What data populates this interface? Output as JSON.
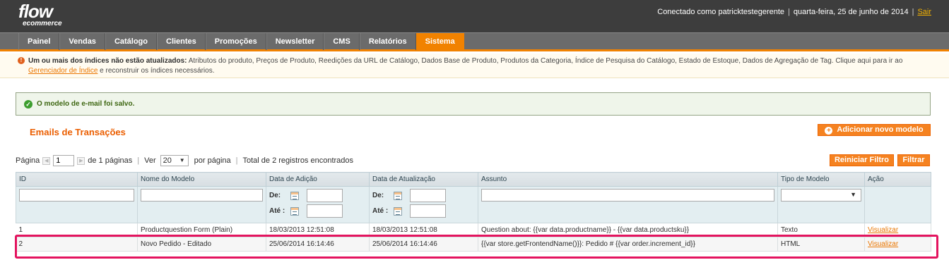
{
  "header": {
    "logo_main": "flow",
    "logo_sub": "ecommerce",
    "logged_in": "Conectado como patricktestegerente",
    "date": "quarta-feira, 25 de junho de 2014",
    "logout": "Sair"
  },
  "nav": {
    "items": [
      {
        "label": "Painel"
      },
      {
        "label": "Vendas"
      },
      {
        "label": "Catálogo"
      },
      {
        "label": "Clientes"
      },
      {
        "label": "Promoções"
      },
      {
        "label": "Newsletter"
      },
      {
        "label": "CMS"
      },
      {
        "label": "Relatórios"
      },
      {
        "label": "Sistema"
      }
    ],
    "active": "Sistema"
  },
  "notice": {
    "bold": "Um ou mais dos índices não estão atualizados:",
    "text": " Atributos do produto, Preços de Produto, Reedições da URL de Catálogo, Dados Base de Produto, Produtos da Categoria, Índice de Pesquisa do Catálogo, Estado de Estoque, Dados de Agregação de Tag. Clique aqui para ir ao ",
    "link": "Gerenciador de Índice",
    "tail": " e reconstruir os índices necessários."
  },
  "success": {
    "message": "O modelo de e-mail foi salvo."
  },
  "page": {
    "title": "Emails de Transações",
    "add_button": "Adicionar novo modelo",
    "reset_button": "Reiniciar Filtro",
    "filter_button": "Filtrar"
  },
  "pager": {
    "page_label": "Página",
    "page_value": "1",
    "of_pages": "de 1 páginas",
    "view_label": "Ver",
    "per_page_value": "20",
    "per_page_label": "por página",
    "total": "Total de 2 registros encontrados"
  },
  "grid": {
    "columns": [
      "ID",
      "Nome do Modelo",
      "Data de Adição",
      "Data de Atualização",
      "Assunto",
      "Tipo de Modelo",
      "Ação"
    ],
    "filter": {
      "from": "De:",
      "to": "Até :"
    },
    "rows": [
      {
        "id": "1",
        "name": "Productquestion Form (Plain)",
        "added": "18/03/2013 12:51:08",
        "updated": "18/03/2013 12:51:08",
        "subject": "Question about: {{var data.productname}} - {{var data.productsku}}",
        "type": "Texto",
        "action": "Visualizar"
      },
      {
        "id": "2",
        "name": "Novo Pedido - Editado",
        "added": "25/06/2014 16:14:46",
        "updated": "25/06/2014 16:14:46",
        "subject": "{{var store.getFrontendName()}}: Pedido # {{var order.increment_id}}",
        "type": "HTML",
        "action": "Visualizar"
      }
    ]
  },
  "colors": {
    "accent": "#f18200",
    "header_bg": "#3d3d3d",
    "nav_bg": "#6b6b6b",
    "highlight": "#e3145f"
  }
}
